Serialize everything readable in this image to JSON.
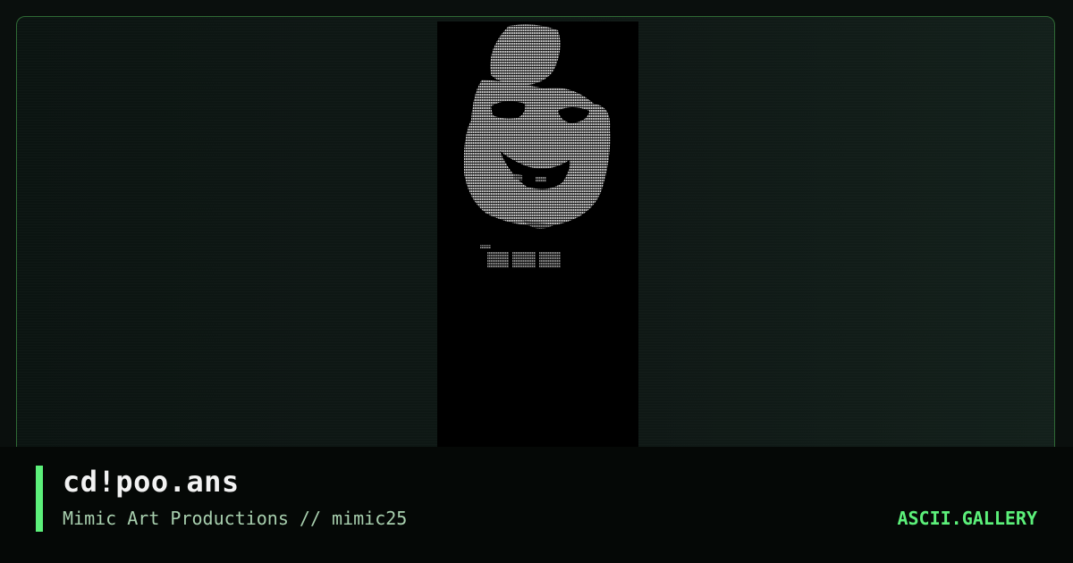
{
  "artwork": {
    "title": "cd!poo.ans",
    "credit": "Mimic Art Productions // mimic25",
    "preview_icon": "ansi-art-thumbnail"
  },
  "site": {
    "brand": "ASCII.GALLERY"
  },
  "colors": {
    "accent": "#5cf07a",
    "background": "#0a0f0d",
    "frame_border": "#2f6a35",
    "art_background": "#000000"
  }
}
